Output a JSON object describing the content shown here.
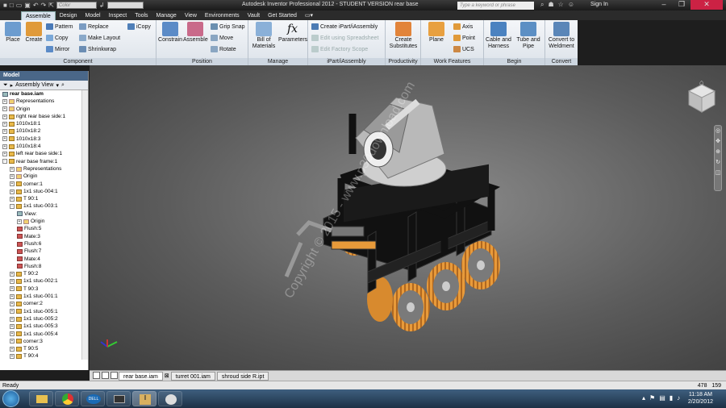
{
  "titlebar": {
    "title": "Autodesk Inventor Professional 2012 - STUDENT VERSION    rear base",
    "color_combo": "Color",
    "search_placeholder": "Type a keyword or phrase",
    "sign_in": "Sign In"
  },
  "ribbon_tabs": [
    "Assemble",
    "Design",
    "Model",
    "Inspect",
    "Tools",
    "Manage",
    "View",
    "Environments",
    "Vault",
    "Get Started"
  ],
  "panels": {
    "component": {
      "label": "Component",
      "place": "Place",
      "create": "Create",
      "pattern": "Pattern",
      "copy": "Copy",
      "mirror": "Mirror",
      "replace": "Replace",
      "make_layout": "Make Layout",
      "shrinkwrap": "Shrinkwrap",
      "icopy": "iCopy"
    },
    "position": {
      "label": "Position",
      "constrain": "Constrain",
      "assemble": "Assemble",
      "grip_snap": "Grip Snap",
      "move": "Move",
      "rotate": "Rotate"
    },
    "manage": {
      "label": "Manage",
      "bom": "Bill of Materials",
      "parameters": "Parameters"
    },
    "ipart": {
      "label": "iPart/iAssembly",
      "create": "Create iPart/iAssembly",
      "edit_spreadsheet": "Edit using Spreadsheet",
      "edit_factory": "Edit Factory Scope"
    },
    "productivity": {
      "label": "Productivity",
      "create_sub": "Create Substitutes"
    },
    "work_features": {
      "label": "Work Features",
      "plane": "Plane",
      "axis": "Axis",
      "point": "Point",
      "ucs": "UCS"
    },
    "begin": {
      "label": "Begin",
      "cable": "Cable and Harness",
      "tube": "Tube and Pipe"
    },
    "convert": {
      "label": "Convert",
      "weldment": "Convert to Weldment"
    }
  },
  "model_browser": {
    "header": "Model",
    "view": "Assembly View"
  },
  "tree": [
    {
      "label": "rear base.iam",
      "d": 0,
      "i": "blue",
      "bold": true
    },
    {
      "label": "Representations",
      "d": 0,
      "i": "fold",
      "e": "+"
    },
    {
      "label": "Origin",
      "d": 0,
      "i": "fold",
      "e": "+"
    },
    {
      "label": "right rear base side:1",
      "d": 0,
      "i": "",
      "e": "+"
    },
    {
      "label": "1010x18:1",
      "d": 0,
      "i": "",
      "e": "+"
    },
    {
      "label": "1010x18:2",
      "d": 0,
      "i": "",
      "e": "+"
    },
    {
      "label": "1010x18:3",
      "d": 0,
      "i": "",
      "e": "+"
    },
    {
      "label": "1010x18:4",
      "d": 0,
      "i": "",
      "e": "+"
    },
    {
      "label": "left rear base side:1",
      "d": 0,
      "i": "",
      "e": "+"
    },
    {
      "label": "rear base frame:1",
      "d": 0,
      "i": "",
      "e": "-"
    },
    {
      "label": "Representations",
      "d": 1,
      "i": "fold",
      "e": "+"
    },
    {
      "label": "Origin",
      "d": 1,
      "i": "fold",
      "e": "+"
    },
    {
      "label": "corner:1",
      "d": 1,
      "i": "",
      "e": "+"
    },
    {
      "label": "1x1 stuc-004:1",
      "d": 1,
      "i": "",
      "e": "+"
    },
    {
      "label": "T 90:1",
      "d": 1,
      "i": "",
      "e": "+"
    },
    {
      "label": "1x1 stuc-003:1",
      "d": 1,
      "i": "",
      "e": "-"
    },
    {
      "label": "View:",
      "d": 2,
      "i": "blue"
    },
    {
      "label": "Origin",
      "d": 2,
      "i": "fold",
      "e": "+"
    },
    {
      "label": "Flush:5",
      "d": 2,
      "i": "red"
    },
    {
      "label": "Mate:3",
      "d": 2,
      "i": "red"
    },
    {
      "label": "Flush:6",
      "d": 2,
      "i": "red"
    },
    {
      "label": "Flush:7",
      "d": 2,
      "i": "red"
    },
    {
      "label": "Mate:4",
      "d": 2,
      "i": "red"
    },
    {
      "label": "Flush:8",
      "d": 2,
      "i": "red"
    },
    {
      "label": "T 90:2",
      "d": 1,
      "i": "",
      "e": "+"
    },
    {
      "label": "1x1 stuc-002:1",
      "d": 1,
      "i": "",
      "e": "+"
    },
    {
      "label": "T 90:3",
      "d": 1,
      "i": "",
      "e": "+"
    },
    {
      "label": "1x1 stuc-001:1",
      "d": 1,
      "i": "",
      "e": "+"
    },
    {
      "label": "corner:2",
      "d": 1,
      "i": "",
      "e": "+"
    },
    {
      "label": "1x1 stuc-005:1",
      "d": 1,
      "i": "",
      "e": "+"
    },
    {
      "label": "1x1 stuc-005:2",
      "d": 1,
      "i": "",
      "e": "+"
    },
    {
      "label": "1x1 stuc-005:3",
      "d": 1,
      "i": "",
      "e": "+"
    },
    {
      "label": "1x1 stuc-005:4",
      "d": 1,
      "i": "",
      "e": "+"
    },
    {
      "label": "corner:3",
      "d": 1,
      "i": "",
      "e": "+"
    },
    {
      "label": "T 90:5",
      "d": 1,
      "i": "",
      "e": "+"
    },
    {
      "label": "T 90:4",
      "d": 1,
      "i": "",
      "e": "+"
    }
  ],
  "doc_tabs": [
    "rear base.iam",
    "turret 001.iam",
    "shroud side R.ipt"
  ],
  "watermark": "Copyright © 2015 - www.p30download.com",
  "status": {
    "text": "Ready",
    "x": "478",
    "y": "159"
  },
  "clock": {
    "time": "11:18 AM",
    "date": "2/20/2012"
  }
}
